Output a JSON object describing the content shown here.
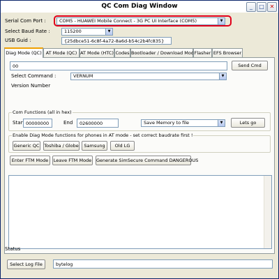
{
  "window": {
    "title": "QC Com Diag Window",
    "minimize": "_",
    "maximize": "□",
    "close": "✕"
  },
  "top": {
    "serial_com_port_label": "Serial Com Port :",
    "serial_com_port_value": "COM5 - HUAWEI Mobile Connect - 3G PC UI Interface (COM5)",
    "baud_rate_label": "Select Baud Rate :",
    "baud_rate_value": "115200",
    "usb_guid_label": "USB Guid :",
    "usb_guid_value": "{25dbce51-6c8f-4a72-8a6d-b54c2b4fc835}"
  },
  "tabs": [
    {
      "label": "Diag Mode (QC)",
      "active": true
    },
    {
      "label": "AT Mode (QC)"
    },
    {
      "label": "AT Mode (HTC)"
    },
    {
      "label": "Codes"
    },
    {
      "label": "Bootloader / Download Mode"
    },
    {
      "label": "Flasher"
    },
    {
      "label": "EFS Browser"
    }
  ],
  "diag": {
    "command_input": "00",
    "send_cmd": "Send Cmd",
    "select_command_label": "Select Command :",
    "select_command_value": "VERNUM",
    "version_number_label": "Version Number",
    "com_functions_label": "Com Functions (all in hex)",
    "start_label": "Start",
    "start_value": "00000000",
    "end_label": "End",
    "end_value": "02600000",
    "action_value": "Save Memory to file",
    "lets_go": "Lets go",
    "enable_diag_label": "Enable Diag Mode functions for phones in AT mode - set correct baudrate first !",
    "generic_qc": "Generic QC",
    "toshiba_globe": "Toshiba / Globe",
    "samsung": "Samsung",
    "old_lg": "Old LG",
    "enter_ftm": "Enter FTM Mode",
    "leave_ftm": "Leave FTM Mode",
    "generate_simsecure": "Generate SimSecure Command DANGEROUS"
  },
  "bottom": {
    "status_label": "Status",
    "select_log_file": "Select Log File",
    "log_file_value": "bytelog"
  },
  "colors": {
    "highlight": "#e0001a",
    "tab_accent": "#f0a000",
    "border": "#7f9db9"
  }
}
